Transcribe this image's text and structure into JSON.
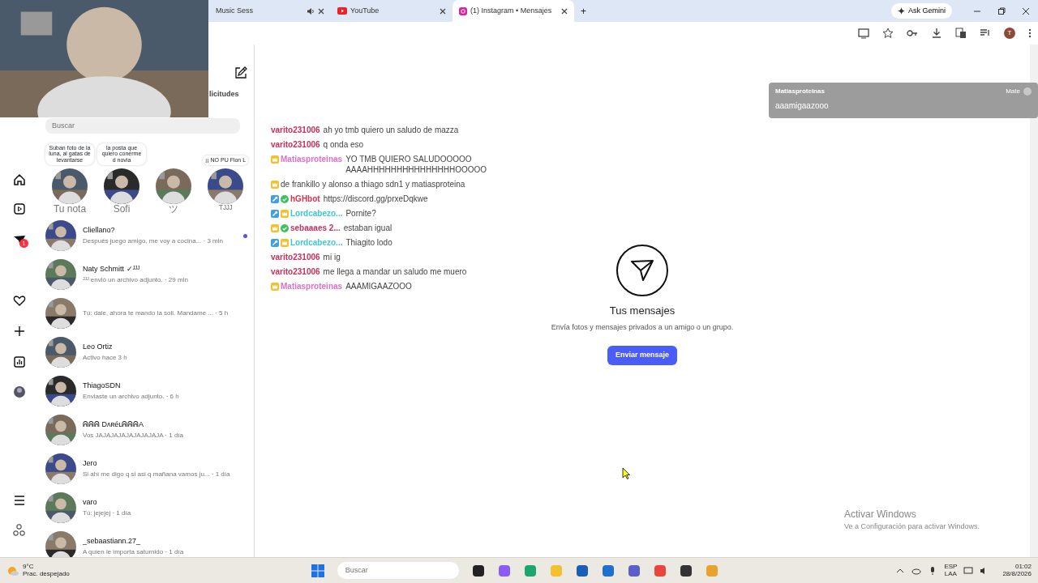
{
  "browser": {
    "tabs": [
      {
        "label": "Music Sess",
        "selected": false,
        "audio": true
      },
      {
        "label": "YouTube",
        "selected": false,
        "audio": false
      },
      {
        "label": "(1) Instagram • Mensajes",
        "selected": true,
        "audio": false
      }
    ],
    "new_tab": "+",
    "gemini": "Ask Gemini",
    "profile": "T"
  },
  "sidebar": {
    "header_partial": "licitudes",
    "search": {
      "placeholder": "Buscar"
    },
    "notes": [
      {
        "bubble": "Suban foto de la luna, al gatas de levantarse",
        "name": "Tu nota"
      },
      {
        "bubble": "la posta que quiero conerme d novia",
        "name": "Sofi"
      },
      {
        "name": "ツ"
      },
      {
        "bubble": "¡¡ NO PU Flon L",
        "name": "ᵀᴶᴶᴶ"
      }
    ],
    "conversations": [
      {
        "name": "Cliellano?",
        "preview": "Después juego amigo, me voy a cocina... · 3 min",
        "unread": true
      },
      {
        "name": "Naty Schmitt ✓ᴶᴶᴶ",
        "preview": "ᴶᴶᴶ envió un archivo adjunto. · 29 min",
        "unread": false
      },
      {
        "preview": "Tú: dale, ahora te mando la soli. Mandame ... · 5 h",
        "unread": false
      },
      {
        "name": "Leo Ortiz",
        "preview": "Activo hace 3 h",
        "unread": false
      },
      {
        "name": "ThiagoSDN",
        "preview": "Enviaste un archivo adjunto. · 6 h",
        "unread": false
      },
      {
        "name": "ᕱᕱᕱ DʌʀéʟᕱᕱᕱA",
        "preview": "Vos JAJAJAJAJAJAJAJAJA · 1 día",
        "unread": false
      },
      {
        "name": "Jero",
        "preview": "Si ahi me digo q si asi q mañana vamos ju... · 1 día",
        "unread": false
      },
      {
        "name": "varo",
        "preview": "Tú: jejejej · 1 día",
        "unread": false
      },
      {
        "name": "_sebaastiann.27_",
        "preview": "A quien le importa saturnido · 1 día",
        "unread": false
      }
    ]
  },
  "nav": {
    "notification_count": "1"
  },
  "main": {
    "title": "Tus mensajes",
    "subtitle": "Envía fotos y mensajes privados a un amigo o un grupo.",
    "button": "Enviar mensaje"
  },
  "chat_overlay": [
    {
      "user": "varito231006",
      "color": "#c8305a",
      "text": "ah yo tmb quiero un saludo de mazza"
    },
    {
      "user": "varito231006",
      "color": "#c8305a",
      "text": "q onda eso"
    },
    {
      "user": "Matiasproteinas",
      "color": "#e070c8",
      "badges": [
        {
          "kind": "crown"
        }
      ],
      "text": "YO TMB QUIERO SALUDOOOOO AAAAHHHHHHHHHHHHHHHOOOOO"
    },
    {
      "badges": [
        {
          "kind": "crown"
        }
      ],
      "text": "de frankillo y alonso a thiago sdn1 y matiasproteina"
    },
    {
      "user": "hGHbot",
      "color": "#e0304a",
      "badges": [
        {
          "kind": "wrench"
        },
        {
          "kind": "check"
        }
      ],
      "text": "https://discord.gg/prxeDqkwe"
    },
    {
      "user": "Lordcabezo...",
      "color": "#38c8d8",
      "badges": [
        {
          "kind": "wrench"
        },
        {
          "kind": "crown"
        }
      ],
      "text": "Pornite?"
    },
    {
      "user": "sebaaaes 2...",
      "color": "#c8305a",
      "badges": [
        {
          "kind": "crown"
        },
        {
          "kind": "check"
        }
      ],
      "text": "estaban igual"
    },
    {
      "user": "Lordcabezo...",
      "color": "#38c8d8",
      "badges": [
        {
          "kind": "wrench"
        },
        {
          "kind": "crown"
        }
      ],
      "text": "Thiagito lodo"
    },
    {
      "user": "varito231006",
      "color": "#c8305a",
      "text": "mi ig"
    },
    {
      "user": "varito231006",
      "color": "#c8305a",
      "text": "me llega a mandar un saludo me muero"
    },
    {
      "user": "Matiasproteinas",
      "color": "#e070c8",
      "badges": [
        {
          "kind": "crown"
        }
      ],
      "text": "AAAMIGAAZOOO"
    }
  ],
  "notification": {
    "user": "Matiasproteinas",
    "tag": "Mate",
    "text": "aaamigaazooo"
  },
  "watermark": {
    "title": "Activar Windows",
    "text": "Ve a Configuración para activar Windows."
  },
  "taskbar": {
    "temperature": "9°C",
    "weather": "Prac. despejado",
    "search": {
      "placeholder": "Buscar"
    },
    "language": "ESP",
    "layout": "LAA",
    "time": "01:02",
    "date": "28/8/2026"
  }
}
